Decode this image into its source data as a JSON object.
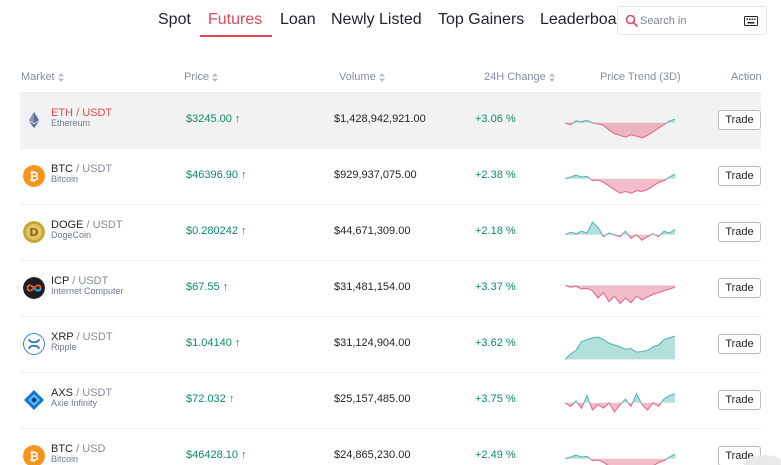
{
  "tabs": [
    {
      "label": "Spot",
      "active": false
    },
    {
      "label": "Futures",
      "active": true
    },
    {
      "label": "Loan",
      "active": false
    },
    {
      "label": "Newly Listed",
      "active": false
    },
    {
      "label": "Top Gainers",
      "active": false
    },
    {
      "label": "Leaderboar",
      "active": false
    }
  ],
  "search": {
    "placeholder": "Search in",
    "value": ""
  },
  "columns": {
    "market": "Market",
    "price": "Price",
    "volume": "Volume",
    "change": "24H Change",
    "trend": "Price Trend (3D)",
    "action": "Action"
  },
  "colors": {
    "accent": "#e0475a",
    "up": "#0a8c6b",
    "trend_up": "#57b8b3",
    "trend_down": "#e26b8a"
  },
  "rows": [
    {
      "base": "ETH",
      "sep": "/",
      "quote": "USDT",
      "name": "Ethereum",
      "price": "$3245.00 ↑",
      "volume": "$1,428,942,921.00",
      "change": "+3.06 %",
      "trade": "Trade",
      "icon": "ethereum-icon",
      "highlighted": true,
      "trend": [
        0.55,
        0.6,
        0.5,
        0.52,
        0.48,
        0.55,
        0.58,
        0.62,
        0.75,
        0.85,
        0.9,
        0.95,
        0.88,
        0.92,
        0.97,
        0.9,
        0.8,
        0.7,
        0.6,
        0.5,
        0.45
      ]
    },
    {
      "base": "BTC",
      "sep": "/",
      "quote": "USDT",
      "name": "Bitcoin",
      "price": "$46396.90 ↑",
      "volume": "$929,937,075.00",
      "change": "+2.38 %",
      "trade": "Trade",
      "icon": "bitcoin-icon",
      "highlighted": false,
      "trend": [
        0.55,
        0.5,
        0.45,
        0.5,
        0.48,
        0.6,
        0.58,
        0.65,
        0.75,
        0.85,
        0.95,
        0.9,
        0.95,
        0.88,
        0.9,
        0.85,
        0.75,
        0.65,
        0.6,
        0.5,
        0.42
      ]
    },
    {
      "base": "DOGE",
      "sep": "/",
      "quote": "USDT",
      "name": "DogeCoin",
      "price": "$0.280242 ↑",
      "volume": "$44,671,309.00",
      "change": "+2.18 %",
      "trade": "Trade",
      "icon": "dogecoin-icon",
      "highlighted": false,
      "trend": [
        0.55,
        0.48,
        0.52,
        0.45,
        0.5,
        0.2,
        0.35,
        0.6,
        0.5,
        0.55,
        0.6,
        0.45,
        0.65,
        0.55,
        0.7,
        0.6,
        0.52,
        0.6,
        0.45,
        0.5,
        0.4
      ]
    },
    {
      "base": "ICP",
      "sep": "/",
      "quote": "USDT",
      "name": "Internet Computer",
      "price": "$67.55 ↑",
      "volume": "$31,481,154.00",
      "change": "+3.37 %",
      "trade": "Trade",
      "icon": "internet-computer-icon",
      "highlighted": false,
      "trend": [
        0.4,
        0.45,
        0.42,
        0.5,
        0.48,
        0.55,
        0.75,
        0.6,
        0.85,
        0.7,
        0.9,
        0.75,
        0.88,
        0.7,
        0.8,
        0.72,
        0.65,
        0.6,
        0.55,
        0.5,
        0.45
      ]
    },
    {
      "base": "XRP",
      "sep": "/",
      "quote": "USDT",
      "name": "Ripple",
      "price": "$1.04140 ↑",
      "volume": "$31,124,904.00",
      "change": "+3.62 %",
      "trade": "Trade",
      "icon": "ripple-icon",
      "highlighted": false,
      "trend": [
        0.9,
        0.75,
        0.65,
        0.4,
        0.35,
        0.3,
        0.28,
        0.35,
        0.45,
        0.5,
        0.55,
        0.62,
        0.6,
        0.7,
        0.68,
        0.65,
        0.55,
        0.5,
        0.35,
        0.3,
        0.25
      ]
    },
    {
      "base": "AXS",
      "sep": "/",
      "quote": "USDT",
      "name": "Axie Infinity",
      "price": "$72.032 ↑",
      "volume": "$25,157,485.00",
      "change": "+3.75 %",
      "trade": "Trade",
      "icon": "axie-infinity-icon",
      "highlighted": false,
      "trend": [
        0.55,
        0.65,
        0.5,
        0.7,
        0.35,
        0.75,
        0.6,
        0.7,
        0.55,
        0.8,
        0.6,
        0.45,
        0.65,
        0.3,
        0.6,
        0.75,
        0.55,
        0.65,
        0.45,
        0.35,
        0.3
      ]
    },
    {
      "base": "BTC",
      "sep": "/",
      "quote": "USD",
      "name": "Bitcoin",
      "price": "$46428.10 ↑",
      "volume": "$24,865,230.00",
      "change": "+2.49 %",
      "trade": "Trade",
      "icon": "bitcoin-icon",
      "highlighted": false,
      "trend": [
        0.55,
        0.5,
        0.45,
        0.5,
        0.48,
        0.6,
        0.58,
        0.65,
        0.75,
        0.85,
        0.95,
        0.9,
        0.95,
        0.88,
        0.9,
        0.85,
        0.75,
        0.65,
        0.6,
        0.5,
        0.42
      ]
    }
  ]
}
